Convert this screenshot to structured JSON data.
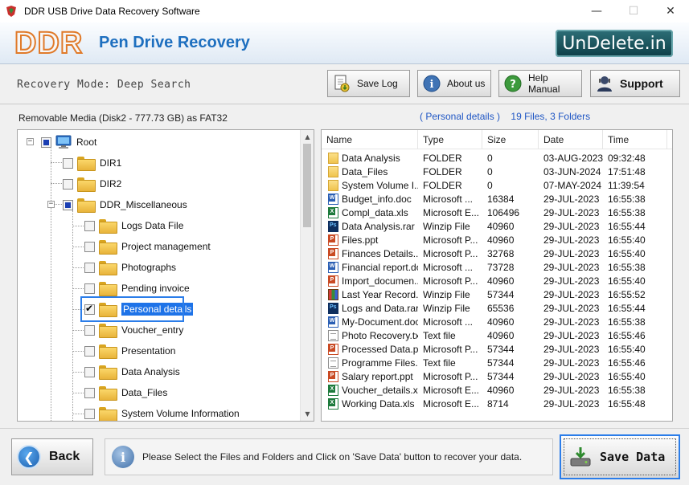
{
  "window": {
    "title": "DDR USB Drive Data Recovery Software"
  },
  "banner": {
    "logo": "DDR",
    "product": "Pen Drive Recovery",
    "brand": "UnDelete.in"
  },
  "toolbar": {
    "mode": "Recovery Mode: Deep Search",
    "save_log": "Save Log",
    "about_us": "About us",
    "help_manual": "Help Manual",
    "support": "Support"
  },
  "status": {
    "media": "Removable Media (Disk2 - 777.73 GB) as FAT32",
    "selected_folder": "( Personal details )",
    "counts": "19 Files, 3 Folders"
  },
  "tree": {
    "root": "Root",
    "dir1": "DIR1",
    "dir2": "DIR2",
    "misc": "DDR_Miscellaneous",
    "children": [
      "Logs Data File",
      "Project management",
      "Photographs",
      "Pending invoice",
      "Personal details",
      "Voucher_entry",
      "Presentation",
      "Data Analysis",
      "Data_Files",
      "System Volume Information"
    ]
  },
  "list": {
    "columns": [
      "Name",
      "Type",
      "Size",
      "Date",
      "Time"
    ],
    "rows": [
      [
        "Data Analysis",
        "FOLDER",
        "0",
        "03-AUG-2023",
        "09:32:48"
      ],
      [
        "Data_Files",
        "FOLDER",
        "0",
        "03-JUN-2024",
        "17:51:48"
      ],
      [
        "System Volume I...",
        "FOLDER",
        "0",
        "07-MAY-2024",
        "11:39:54"
      ],
      [
        "Budget_info.doc",
        "Microsoft ...",
        "16384",
        "29-JUL-2023",
        "16:55:38"
      ],
      [
        "Compl_data.xls",
        "Microsoft E...",
        "106496",
        "29-JUL-2023",
        "16:55:38"
      ],
      [
        "Data Analysis.rar",
        "Winzip File",
        "40960",
        "29-JUL-2023",
        "16:55:44"
      ],
      [
        "Files.ppt",
        "Microsoft P...",
        "40960",
        "29-JUL-2023",
        "16:55:40"
      ],
      [
        "Finances Details....",
        "Microsoft P...",
        "32768",
        "29-JUL-2023",
        "16:55:40"
      ],
      [
        "Financial report.doc",
        "Microsoft ...",
        "73728",
        "29-JUL-2023",
        "16:55:38"
      ],
      [
        "Import_documen...",
        "Microsoft P...",
        "40960",
        "29-JUL-2023",
        "16:55:40"
      ],
      [
        "Last Year Record....",
        "Winzip File",
        "57344",
        "29-JUL-2023",
        "16:55:52"
      ],
      [
        "Logs and Data.rar",
        "Winzip File",
        "65536",
        "29-JUL-2023",
        "16:55:44"
      ],
      [
        "My-Document.doc",
        "Microsoft ...",
        "40960",
        "29-JUL-2023",
        "16:55:38"
      ],
      [
        "Photo Recovery.txt",
        "Text file",
        "40960",
        "29-JUL-2023",
        "16:55:46"
      ],
      [
        "Processed Data.ppt",
        "Microsoft P...",
        "57344",
        "29-JUL-2023",
        "16:55:40"
      ],
      [
        "Programme Files.txt",
        "Text file",
        "57344",
        "29-JUL-2023",
        "16:55:46"
      ],
      [
        "Salary report.ppt",
        "Microsoft P...",
        "57344",
        "29-JUL-2023",
        "16:55:40"
      ],
      [
        "Voucher_details.xls",
        "Microsoft E...",
        "40960",
        "29-JUL-2023",
        "16:55:38"
      ],
      [
        "Working Data.xls",
        "Microsoft E...",
        "8714",
        "29-JUL-2023",
        "16:55:48"
      ]
    ],
    "icons": [
      "folder",
      "folder",
      "folder",
      "doc",
      "xls",
      "rar",
      "ppt",
      "ppt",
      "doc",
      "ppt",
      "rec",
      "rar",
      "doc",
      "txt",
      "ppt",
      "txt",
      "ppt",
      "xls",
      "xls"
    ]
  },
  "bottom": {
    "back": "Back",
    "info": "Please Select the Files and Folders and Click on 'Save Data' button to recover your data.",
    "save_data": "Save Data"
  },
  "colors": {
    "accent": "#2b7de9",
    "selection": "#1e73e8",
    "product": "#1e6fbf",
    "logo_stroke": "#e07a2a",
    "brand_bg": "#0e3f47"
  },
  "icons": {
    "app": "app-icon",
    "save_log": "save-log-icon",
    "about": "info-icon",
    "help": "help-icon",
    "support": "support-person-icon",
    "root": "computer-icon",
    "back": "back-arrow-icon",
    "info": "info-icon",
    "save": "drive-download-icon"
  }
}
